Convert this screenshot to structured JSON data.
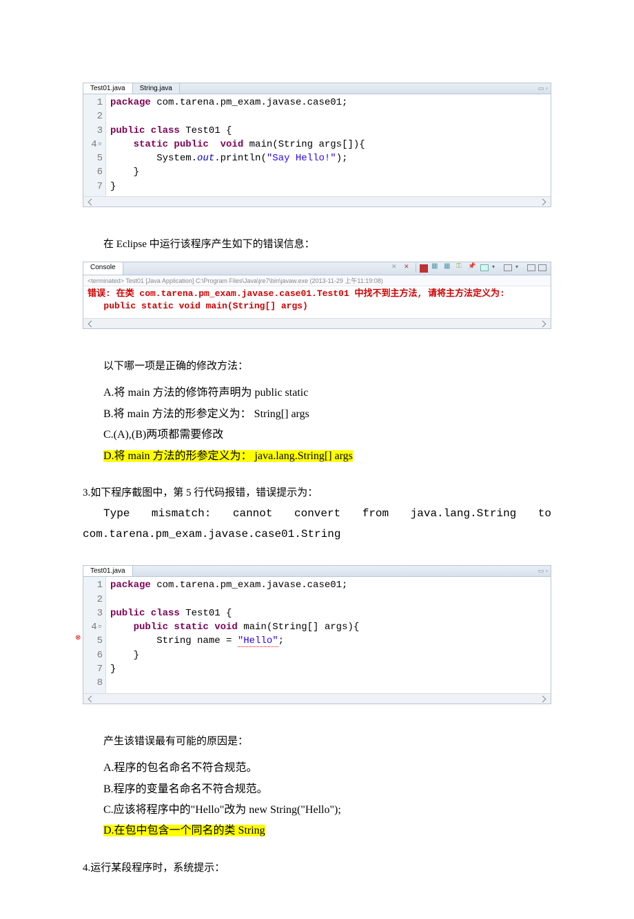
{
  "editor1": {
    "tabs": [
      "Test01.java",
      "String.java"
    ],
    "gutter": [
      "1",
      "2",
      "3",
      "4",
      "5",
      "6",
      "7"
    ],
    "code": {
      "l1_pre": "package",
      "l1_rest": " com.tarena.pm_exam.javase.case01;",
      "l3_pre": "public class",
      "l3_rest": " Test01 {",
      "l4a": "static public  void",
      "l4b": " main(String args[]){",
      "l5a": "System.",
      "l5b": "out",
      "l5c": ".println(",
      "l5d": "\"Say Hello!\"",
      "l5e": ");",
      "l6": "}",
      "l7": "}"
    }
  },
  "text1": "在 Eclipse 中运行该程序产生如下的错误信息：",
  "console": {
    "label": "Console",
    "sub": "<terminated> Test01 [Java Application] C:\\Program Files\\Java\\jre7\\bin\\javaw.exe (2013-11-29 上午11:19:08)",
    "line1": "错误: 在类 com.tarena.pm_exam.javase.case01.Test01 中找不到主方法, 请将主方法定义为:",
    "line2": "   public static void main(String[] args)"
  },
  "q2": {
    "prompt": "以下哪一项是正确的修改方法：",
    "A": "A.将 main 方法的修饰符声明为 public static",
    "B": "B.将 main 方法的形参定义为： String[] args",
    "C": "C.(A),(B)两项都需要修改",
    "D": "D.将 main 方法的形参定义为： java.lang.String[] args"
  },
  "q3": {
    "heading": "3.如下程序截图中，第 5 行代码报错，错误提示为：",
    "err_pre": "Type   mismatch:   cannot   convert   from   java.lang.String   to",
    "err_post": "com.tarena.pm_exam.javase.case01.String"
  },
  "editor2": {
    "tabs": [
      "Test01.java"
    ],
    "gutter": [
      "1",
      "2",
      "3",
      "4",
      "5",
      "6",
      "7",
      "8"
    ],
    "code": {
      "l1_pre": "package",
      "l1_rest": " com.tarena.pm_exam.javase.case01;",
      "l3_pre": "public class",
      "l3_rest": " Test01 {",
      "l4a": "public static void",
      "l4b": " main(String[] args){",
      "l5a": "String name = ",
      "l5b": "\"Hello\"",
      "l5c": ";",
      "l6": "}",
      "l7": "}"
    }
  },
  "q3b": {
    "prompt": "产生该错误最有可能的原因是：",
    "A": "A.程序的包名命名不符合规范。",
    "B": "B.程序的变量名命名不符合规范。",
    "C": "C.应该将程序中的\"Hello\"改为 new String(\"Hello\");",
    "D": "D.在包中包含一个同名的类 String"
  },
  "q4": "4.运行某段程序时，系统提示："
}
